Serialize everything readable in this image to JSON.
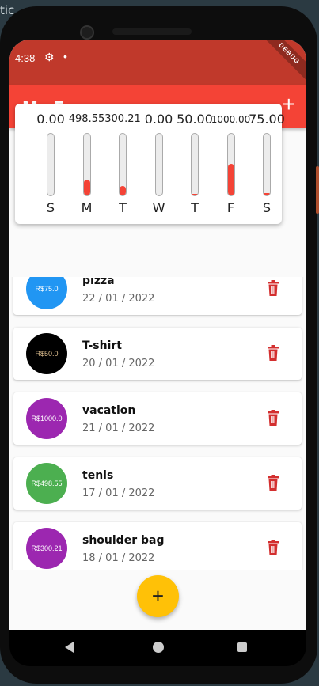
{
  "background_text": "tic",
  "status_bar": {
    "time": "4:38",
    "settings_icon": "gear-icon",
    "dot": "•",
    "right_icons": "▾ ▮",
    "debug_banner": "DEBUG",
    "color": "#c0392b"
  },
  "app_bar": {
    "title": "My Expenses",
    "add_icon": "+",
    "color": "#f44336"
  },
  "chart_data": {
    "type": "bar",
    "categories": [
      "S",
      "M",
      "T",
      "W",
      "T",
      "F",
      "S"
    ],
    "values": [
      0.0,
      498.55,
      300.21,
      0.0,
      50.0,
      1000.0,
      75.0
    ],
    "value_labels": [
      "0.00",
      "498.55",
      "300.21",
      "0.00",
      "50.00",
      "1000.00",
      "75.00"
    ],
    "fill_fraction": [
      0.0,
      0.2572,
      0.1549,
      0.0,
      0.0258,
      0.5159,
      0.0387
    ],
    "bar_color": "#f44336"
  },
  "expenses": [
    {
      "avatar_text": "R$75.0",
      "title": "pizza",
      "date": "22 / 01 / 2022",
      "color": "#2196f3",
      "text_color": "#ffffff"
    },
    {
      "avatar_text": "R$50.0",
      "title": "T-shirt",
      "date": "20 / 01 / 2022",
      "color": "#000000",
      "text_color": "#e0c090"
    },
    {
      "avatar_text": "R$1000.0",
      "title": "vacation",
      "date": "21 / 01 / 2022",
      "color": "#9c27b0",
      "text_color": "#ffffff"
    },
    {
      "avatar_text": "R$498.55",
      "title": "tenis",
      "date": "17 / 01 / 2022",
      "color": "#4caf50",
      "text_color": "#ffffff"
    },
    {
      "avatar_text": "R$300.21",
      "title": "shoulder bag",
      "date": "18 / 01 / 2022",
      "color": "#9c27b0",
      "text_color": "#ffffff"
    }
  ],
  "fab": {
    "label": "+",
    "color": "#ffc107"
  },
  "icons": {
    "delete": "trash-icon",
    "back": "back-icon",
    "home": "home-icon",
    "recents": "recents-icon"
  }
}
